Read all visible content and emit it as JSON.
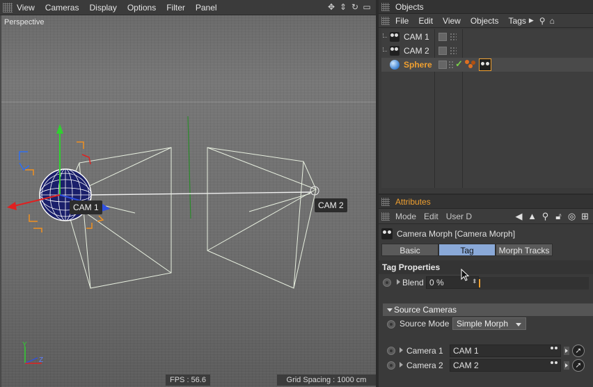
{
  "viewport": {
    "menu": [
      "View",
      "Cameras",
      "Display",
      "Options",
      "Filter",
      "Panel"
    ],
    "view_name": "Perspective",
    "cam1_label": "CAM 1",
    "cam2_label": "CAM 2",
    "axis_y": "Y",
    "axis_z": "Z",
    "axis_x": "X",
    "fps": "FPS : 56.6",
    "grid_spacing": "Grid Spacing : 1000 cm"
  },
  "objects": {
    "title": "Objects",
    "menu": [
      "File",
      "Edit",
      "View",
      "Objects",
      "Tags"
    ],
    "items": [
      {
        "name": "CAM 1",
        "icon": "camera-icon"
      },
      {
        "name": "CAM 2",
        "icon": "camera-icon"
      },
      {
        "name": "Sphere",
        "icon": "sphere-icon",
        "selected": true
      }
    ]
  },
  "attributes": {
    "title": "Attributes",
    "menu": [
      "Mode",
      "Edit",
      "User D"
    ],
    "tag_title": "Camera Morph [Camera Morph]",
    "tabs": [
      {
        "label": "Basic",
        "active": false
      },
      {
        "label": "Tag",
        "active": true
      },
      {
        "label": "Morph Tracks",
        "active": false
      }
    ],
    "tag_properties_header": "Tag Properties",
    "blend_label": "Blend",
    "blend_value": "0 %",
    "blend_fraction": 0,
    "source_cameras_header": "Source Cameras",
    "source_mode_label": "Source Mode",
    "source_mode_value": "Simple Morph",
    "camera1_label": "Camera 1",
    "camera1_value": "CAM 1",
    "camera2_label": "Camera 2",
    "camera2_value": "CAM 2"
  },
  "colors": {
    "accent_orange": "#f0a030",
    "tab_active": "#8aa9d8",
    "axis_x": "#e02020",
    "axis_y": "#30d030",
    "axis_z": "#3050e0"
  }
}
